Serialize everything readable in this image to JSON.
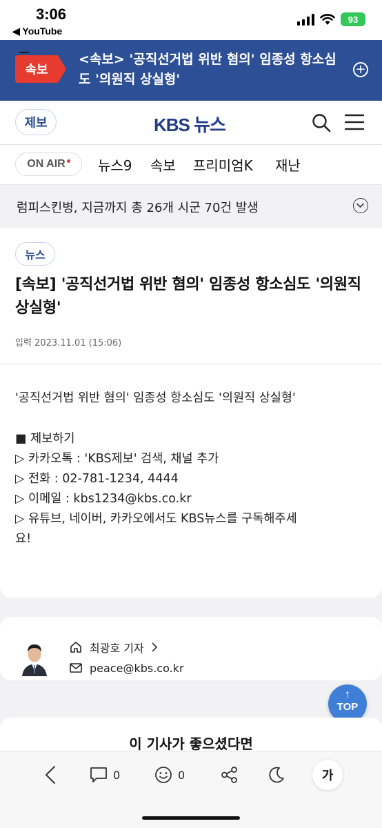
{
  "status_bar": {
    "time": "3:06",
    "back_app": "◀ YouTube",
    "battery": "93"
  },
  "breaking": {
    "badge": "속보",
    "headline": "<속보> '공직선거법 위반 혐의' 임종성 항소심도 '의원직 상실형'"
  },
  "header": {
    "tip_button": "제보",
    "logo": "KBS 뉴스"
  },
  "nav": {
    "on_air": "ON AIR",
    "items": [
      "뉴스9",
      "속보",
      "프리미엄K",
      "재난"
    ]
  },
  "ticker": {
    "text": "럼피스킨병, 지금까지 총 26개 시군 70건 발생"
  },
  "article": {
    "category": "뉴스",
    "title": "[속보] '공직선거법 위반 혐의' 임종성 항소심도 '의원직 상실형'",
    "date": "입력 2023.11.01 (15:06)",
    "lead": "'공직선거법 위반 혐의' 임종성 항소심도 '의원직 상실형'",
    "report_heading": "■ 제보하기",
    "report_lines": [
      "▷ 카카오톡 : 'KBS제보' 검색, 채널 추가",
      "▷ 전화 : 02-781-1234, 4444",
      "▷ 이메일 : kbs1234@kbs.co.kr",
      "▷ 유튜브, 네이버, 카카오에서도 KBS뉴스를 구독해주세",
      "요!"
    ]
  },
  "author": {
    "name": "최광호 기자",
    "email": "peace@kbs.co.kr"
  },
  "top_button": "TOP",
  "like_section": {
    "text": "이 기사가 좋으셨다면"
  },
  "toolbar": {
    "comment_count": "0",
    "reaction_count": "0",
    "font_label": "가"
  },
  "colors": {
    "brand_blue": "#2d4f95",
    "breaking_red": "#e63b2e",
    "top_button": "#3f7fd6"
  }
}
